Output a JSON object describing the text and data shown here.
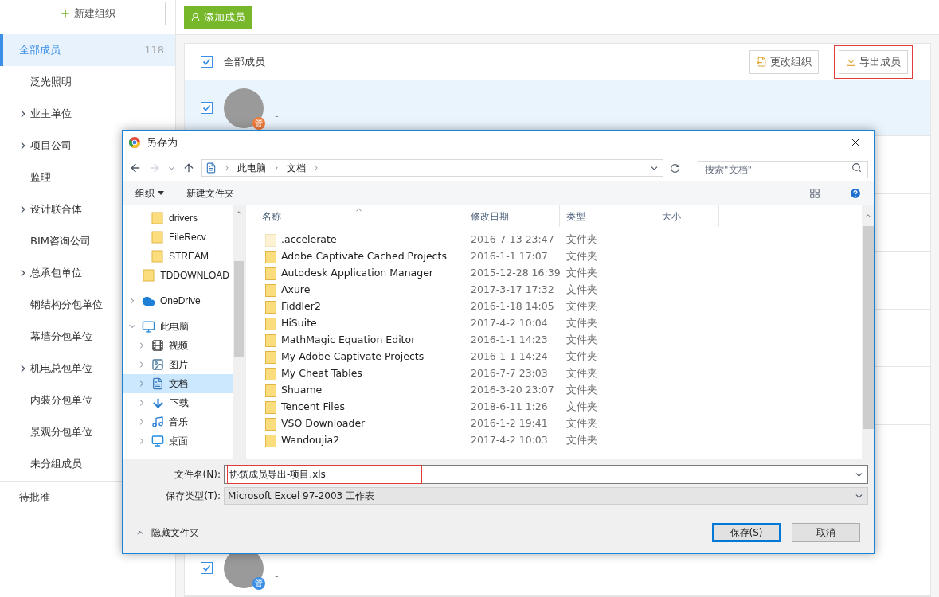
{
  "sidebar": {
    "new_button": "新建组织",
    "items": [
      {
        "label": "全部成员",
        "count": "118",
        "kind": "leaf",
        "selected": true
      },
      {
        "label": "泛光照明",
        "kind": "leaf",
        "selected": false
      },
      {
        "label": "业主单位",
        "kind": "group",
        "selected": false
      },
      {
        "label": "项目公司",
        "kind": "group",
        "selected": false
      },
      {
        "label": "监理",
        "kind": "leaf",
        "selected": false
      },
      {
        "label": "设计联合体",
        "kind": "group",
        "selected": false
      },
      {
        "label": "BIM咨询公司",
        "kind": "leaf",
        "selected": false
      },
      {
        "label": "总承包单位",
        "kind": "group",
        "selected": false
      },
      {
        "label": "钢结构分包单位",
        "kind": "leaf",
        "selected": false
      },
      {
        "label": "幕墙分包单位",
        "kind": "leaf",
        "selected": false
      },
      {
        "label": "机电总包单位",
        "kind": "group",
        "selected": false
      },
      {
        "label": "内装分包单位",
        "kind": "leaf",
        "selected": false
      },
      {
        "label": "景观分包单位",
        "kind": "leaf",
        "selected": false
      },
      {
        "label": "未分组成员",
        "kind": "leaf",
        "selected": false
      }
    ],
    "pending": "待批准"
  },
  "toolbar": {
    "add_button": "添加成员"
  },
  "members": {
    "header": {
      "label": "全部成员",
      "checked": true
    },
    "buttons": [
      {
        "label": "更改组织",
        "kind": "move",
        "highlighted": false
      },
      {
        "label": "导出成员",
        "kind": "export",
        "highlighted": true
      }
    ],
    "rows": [
      {
        "subtitle": "-",
        "checked": true,
        "selected": true,
        "badge": "管",
        "color": "#f07c3c"
      },
      {
        "subtitle": "-",
        "checked": true,
        "selected": false,
        "badge": "管",
        "color": "#3a8ee6"
      }
    ]
  },
  "dialog": {
    "title": "另存为",
    "breadcrumb": [
      "此电脑",
      "文档"
    ],
    "search": {
      "placeholder": "搜索\"文档\""
    },
    "commands": {
      "organize": "组织",
      "new_folder": "新建文件夹"
    },
    "tree": [
      {
        "label": "drivers",
        "kind": "folder",
        "selected": false
      },
      {
        "label": "FileRecv",
        "kind": "folder",
        "selected": false
      },
      {
        "label": "STREAM",
        "kind": "folder",
        "selected": false
      },
      {
        "label": "TDDOWNLOAD",
        "kind": "folder",
        "selected": false
      },
      {
        "label": "OneDrive",
        "kind": "cloud",
        "expanded": false,
        "selected": false
      },
      {
        "label": "此电脑",
        "kind": "computer",
        "expanded": true,
        "selected": false,
        "children": [
          {
            "label": "视频",
            "kind": "video",
            "expanded": false,
            "selected": false
          },
          {
            "label": "图片",
            "kind": "picture",
            "expanded": false,
            "selected": false
          },
          {
            "label": "文档",
            "kind": "document",
            "expanded": false,
            "selected": true
          },
          {
            "label": "下载",
            "kind": "download",
            "expanded": false,
            "selected": false
          },
          {
            "label": "音乐",
            "kind": "music",
            "expanded": false,
            "selected": false
          },
          {
            "label": "桌面",
            "kind": "desktop",
            "expanded": false,
            "selected": false
          }
        ]
      }
    ],
    "columns": [
      "名称",
      "修改日期",
      "类型",
      "大小"
    ],
    "files": [
      {
        "name": ".accelerate",
        "date": "2016-7-13 23:47",
        "type": "文件夹",
        "hidden": true
      },
      {
        "name": "Adobe Captivate Cached Projects",
        "date": "2016-1-1 17:07",
        "type": "文件夹",
        "hidden": false
      },
      {
        "name": "Autodesk Application Manager",
        "date": "2015-12-28 16:39",
        "type": "文件夹",
        "hidden": false
      },
      {
        "name": "Axure",
        "date": "2017-3-17 17:32",
        "type": "文件夹",
        "hidden": false
      },
      {
        "name": "Fiddler2",
        "date": "2016-1-18 14:05",
        "type": "文件夹",
        "hidden": false
      },
      {
        "name": "HiSuite",
        "date": "2017-4-2 10:04",
        "type": "文件夹",
        "hidden": false
      },
      {
        "name": "MathMagic Equation Editor",
        "date": "2016-1-1 14:23",
        "type": "文件夹",
        "hidden": false
      },
      {
        "name": "My Adobe Captivate Projects",
        "date": "2016-1-1 14:24",
        "type": "文件夹",
        "hidden": false
      },
      {
        "name": "My Cheat Tables",
        "date": "2016-7-7 23:03",
        "type": "文件夹",
        "hidden": false
      },
      {
        "name": "Shuame",
        "date": "2016-3-20 23:07",
        "type": "文件夹",
        "hidden": false
      },
      {
        "name": "Tencent Files",
        "date": "2018-6-11 1:26",
        "type": "文件夹",
        "hidden": false
      },
      {
        "name": "VSO Downloader",
        "date": "2016-1-2 19:41",
        "type": "文件夹",
        "hidden": false
      },
      {
        "name": "Wandoujia2",
        "date": "2017-4-2 10:03",
        "type": "文件夹",
        "hidden": false
      }
    ],
    "filename": {
      "label": "文件名(N):",
      "value": "协筑成员导出-项目.xls",
      "highlighted": true
    },
    "filetype": {
      "label": "保存类型(T):",
      "value": "Microsoft Excel 97-2003 工作表"
    },
    "hide_folders": "隐藏文件夹",
    "save": "保存(S)",
    "cancel": "取消"
  }
}
